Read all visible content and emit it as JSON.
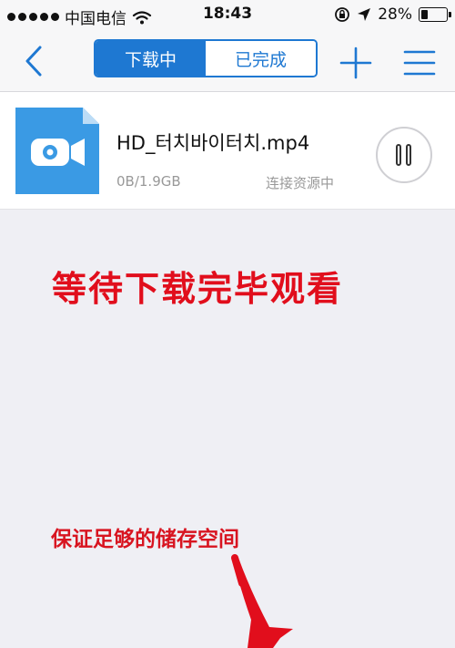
{
  "status_bar": {
    "carrier": "中国电信",
    "time": "18:43",
    "battery_percent": "28%",
    "battery_level": 0.28,
    "icons": [
      "signal-dots-icon",
      "wifi-icon",
      "rotation-lock-icon",
      "location-arrow-icon",
      "battery-icon"
    ]
  },
  "nav": {
    "back_icon": "chevron-left-icon",
    "tabs": [
      {
        "label": "下载中",
        "active": true
      },
      {
        "label": "已完成",
        "active": false
      }
    ],
    "add_icon": "plus-icon",
    "menu_icon": "hamburger-menu-icon"
  },
  "download_item": {
    "icon": "video-file-icon",
    "file_name": "HD_터치바이터치.mp4",
    "size": "0B/1.9GB",
    "status": "连接资源中",
    "control_icon": "pause-icon"
  },
  "annotations": {
    "headline": "等待下载完毕观看",
    "note": "保证足够的储存空间",
    "arrow_icon": "red-arrow-icon"
  },
  "colors": {
    "accent": "#1e78d2",
    "annotation_red": "#e10e1c",
    "file_icon_blue": "#3a9ae4"
  }
}
